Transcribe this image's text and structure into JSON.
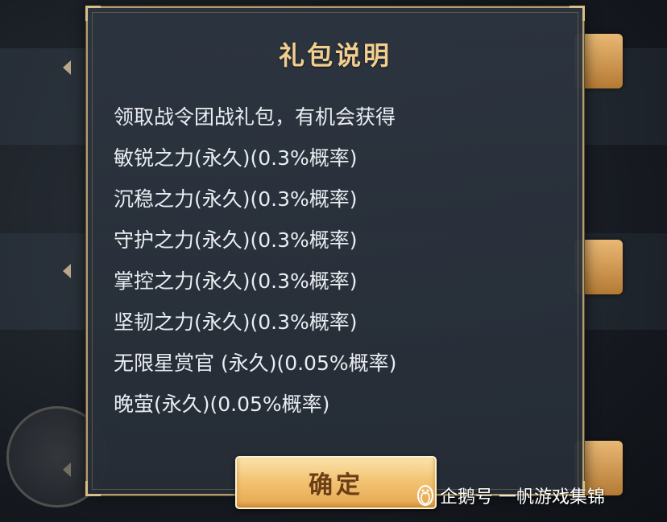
{
  "dialog": {
    "title": "礼包说明",
    "lines": [
      "领取战令团战礼包，有机会获得",
      "敏锐之力(永久)(0.3%概率)",
      "沉稳之力(永久)(0.3%概率)",
      "守护之力(永久)(0.3%概率)",
      "掌控之力(永久)(0.3%概率)",
      "坚韧之力(永久)(0.3%概率)",
      "无限星赏官 (永久)(0.05%概率)",
      "晚萤(永久)(0.05%概率)"
    ],
    "confirm_label": "确定"
  },
  "watermark": {
    "text": "企鹅号 一帆游戏集锦",
    "icon": "penguin-icon"
  },
  "colors": {
    "title": "#f2cf8e",
    "text": "#e9edf1",
    "button": "#f3c474",
    "border": "#b49d6d"
  }
}
